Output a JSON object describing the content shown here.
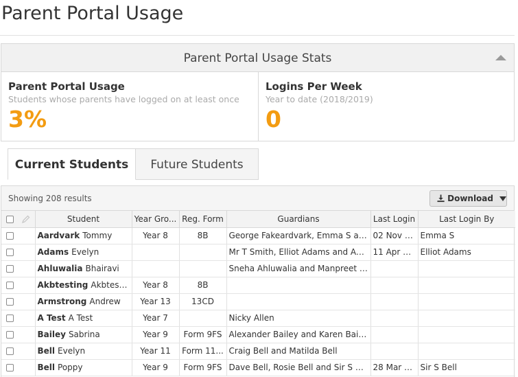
{
  "page": {
    "title": "Parent Portal Usage"
  },
  "stats": {
    "header": "Parent Portal Usage Stats",
    "usage": {
      "title": "Parent Portal Usage",
      "subtitle": "Students whose parents have logged on at least once",
      "value": "3%"
    },
    "logins": {
      "title": "Logins Per Week",
      "subtitle": "Year to date (2018/2019)",
      "value": "0"
    },
    "accent_color": "#f39c12"
  },
  "tabs": [
    {
      "label": "Current Students",
      "active": true
    },
    {
      "label": "Future Students",
      "active": false
    }
  ],
  "results": {
    "count_text": "Showing 208 results",
    "download_label": "Download",
    "columns": [
      "Student",
      "Year Gro...",
      "Reg. Form",
      "Guardians",
      "Last Login",
      "Last Login By"
    ],
    "rows": [
      {
        "surname": "Aardvark",
        "firstname": "Tommy",
        "year": "Year 8",
        "form": "8B",
        "guardians": "George Fakeardvark, Emma S and ...",
        "last_login": "02 Nov 2...",
        "last_login_by": "Emma S"
      },
      {
        "surname": "Adams",
        "firstname": "Evelyn",
        "year": "",
        "form": "",
        "guardians": "Mr T Smith, Elliot Adams and Adel...",
        "last_login": "11 Apr 2...",
        "last_login_by": "Elliot Adams"
      },
      {
        "surname": "Ahluwalia",
        "firstname": "Bhairavi",
        "year": "",
        "form": "",
        "guardians": "Sneha Ahluwalia and Manpreet Ah...",
        "last_login": "",
        "last_login_by": ""
      },
      {
        "surname": "Akbtesting",
        "firstname": "Akbtesting",
        "year": "Year 8",
        "form": "8B",
        "guardians": "",
        "last_login": "",
        "last_login_by": ""
      },
      {
        "surname": "Armstrong",
        "firstname": "Andrew",
        "year": "Year 13",
        "form": "13CD",
        "guardians": "",
        "last_login": "",
        "last_login_by": ""
      },
      {
        "surname": "A Test",
        "firstname": "A Test",
        "year": "Year 7",
        "form": "",
        "guardians": "Nicky Allen",
        "last_login": "",
        "last_login_by": ""
      },
      {
        "surname": "Bailey",
        "firstname": "Sabrina",
        "year": "Year 9",
        "form": "Form 9FS",
        "guardians": "Alexander Bailey and Karen Bailey",
        "last_login": "",
        "last_login_by": ""
      },
      {
        "surname": "Bell",
        "firstname": "Evelyn",
        "year": "Year 11",
        "form": "Form 11...",
        "guardians": "Craig Bell and Matilda Bell",
        "last_login": "",
        "last_login_by": ""
      },
      {
        "surname": "Bell",
        "firstname": "Poppy",
        "year": "Year 9",
        "form": "Form 9FS",
        "guardians": "Dave Bell, Rosie Bell and Sir S Bell",
        "last_login": "28 Mar 2...",
        "last_login_by": "Sir S Bell"
      }
    ]
  }
}
